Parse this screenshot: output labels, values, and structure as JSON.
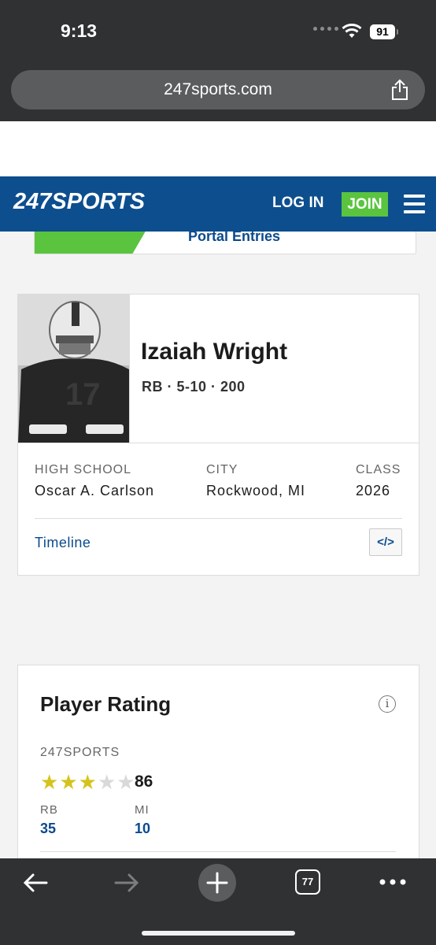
{
  "status_bar": {
    "time": "9:13",
    "battery": "91"
  },
  "browser": {
    "url": "247sports.com"
  },
  "site_nav": {
    "logo": "247SPORTS",
    "login_label": "LOG IN",
    "join_label": "JOIN",
    "accent_color": "#0d4e8e",
    "join_color": "#5ac43f"
  },
  "partial_card": {
    "text": "Portal Entries"
  },
  "player": {
    "name": "Izaiah Wright",
    "meta": "RB · 5-10 · 200",
    "high_school_label": "HIGH SCHOOL",
    "high_school": "Oscar A. Carlson",
    "city_label": "CITY",
    "city": "Rockwood, MI",
    "class_label": "CLASS",
    "class": "2026",
    "timeline_label": "Timeline",
    "embed_label": "</>"
  },
  "rating": {
    "title": "Player Rating",
    "info_icon": "i",
    "source": "247SPORTS",
    "stars_filled": 3,
    "stars_total": 5,
    "score": "86",
    "position_label": "RB",
    "position_rank": "35",
    "state_label": "MI",
    "state_rank": "10"
  },
  "toolbar": {
    "tabs_count": "77"
  }
}
